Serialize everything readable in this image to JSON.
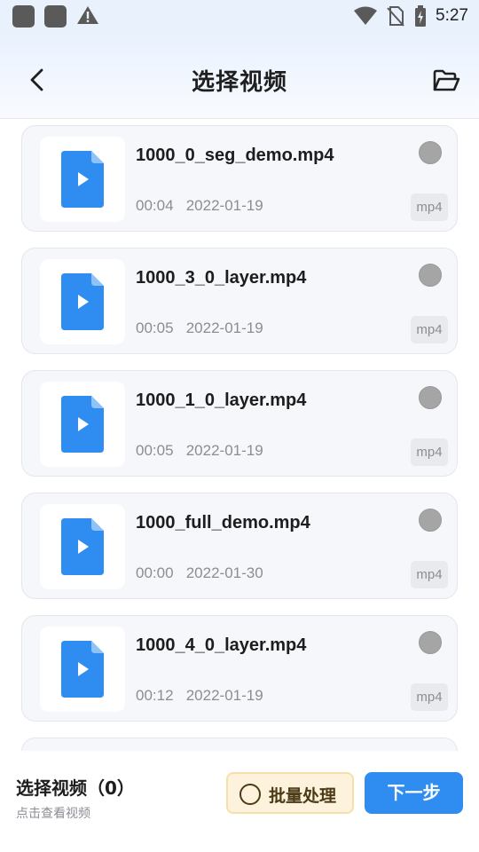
{
  "status_bar": {
    "time": "5:27",
    "icons": [
      "app-icon",
      "app-icon",
      "warning-icon",
      "wifi-icon",
      "no-sim-icon",
      "battery-charging-icon"
    ]
  },
  "header": {
    "title": "选择视频",
    "back_icon": "back-arrow-icon",
    "folder_icon": "folder-open-icon"
  },
  "videos": [
    {
      "name": "1000_0_seg_demo.mp4",
      "duration": "00:04",
      "date": "2022-01-19",
      "ext": "mp4",
      "selected": false
    },
    {
      "name": "1000_3_0_layer.mp4",
      "duration": "00:05",
      "date": "2022-01-19",
      "ext": "mp4",
      "selected": false
    },
    {
      "name": "1000_1_0_layer.mp4",
      "duration": "00:05",
      "date": "2022-01-19",
      "ext": "mp4",
      "selected": false
    },
    {
      "name": "1000_full_demo.mp4",
      "duration": "00:00",
      "date": "2022-01-30",
      "ext": "mp4",
      "selected": false
    },
    {
      "name": "1000_4_0_layer.mp4",
      "duration": "00:12",
      "date": "2022-01-19",
      "ext": "mp4",
      "selected": false
    }
  ],
  "footer": {
    "title": "选择视频（0）",
    "hint": "点击查看视频",
    "batch_label": "批量处理",
    "next_label": "下一步"
  },
  "colors": {
    "accent": "#2f8df1",
    "batch_bg": "#fdf3dc",
    "batch_text": "#4b3a15",
    "card_bg": "#f5f7fb"
  }
}
